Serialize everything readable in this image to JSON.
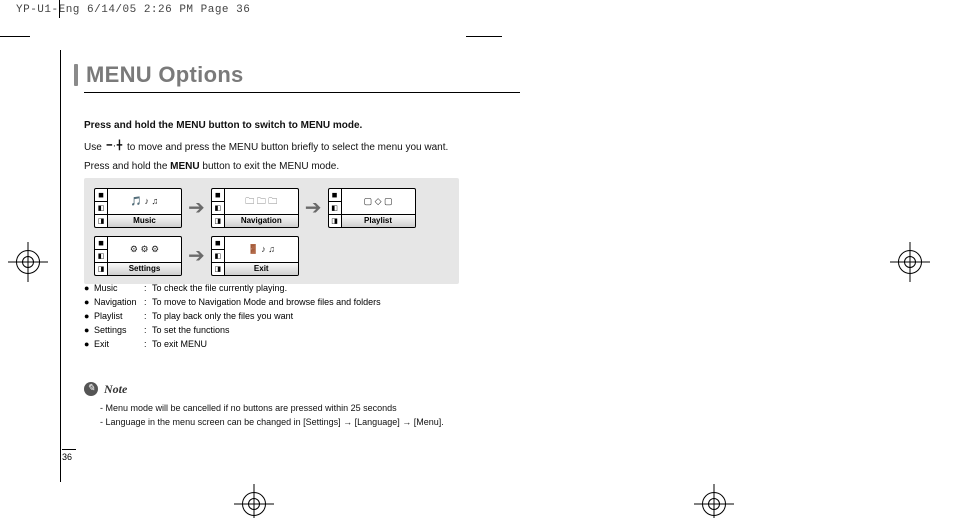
{
  "print_header": "YP-U1-Eng  6/14/05 2:26 PM  Page 36",
  "title": "MENU Options",
  "instructions": {
    "hold_line": "Press and hold the MENU button to switch to MENU mode.",
    "use_prefix": "Use ",
    "use_suffix": " to move and press the MENU button briefly to select the menu you want.",
    "exit_line_pre": "Press and hold the ",
    "exit_line_bold": "MENU",
    "exit_line_post": " button to exit the MENU mode."
  },
  "screens": {
    "row1": [
      "Music",
      "Navigation",
      "Playlist"
    ],
    "row2": [
      "Settings",
      "Exit"
    ]
  },
  "definitions": [
    {
      "term": "Music",
      "desc": "To check the file currently playing."
    },
    {
      "term": "Navigation",
      "desc": "To move to Navigation Mode and browse files and folders"
    },
    {
      "term": "Playlist",
      "desc": "To play back only the files you want"
    },
    {
      "term": "Settings",
      "desc": "To set the functions"
    },
    {
      "term": "Exit",
      "desc": "To exit MENU"
    }
  ],
  "note": {
    "label": "Note",
    "lines": [
      "Menu mode will be cancelled if no buttons are pressed within 25 seconds",
      "Language in the menu screen can be changed in [Settings] → [Language] → [Menu]."
    ]
  },
  "page_number": "36"
}
